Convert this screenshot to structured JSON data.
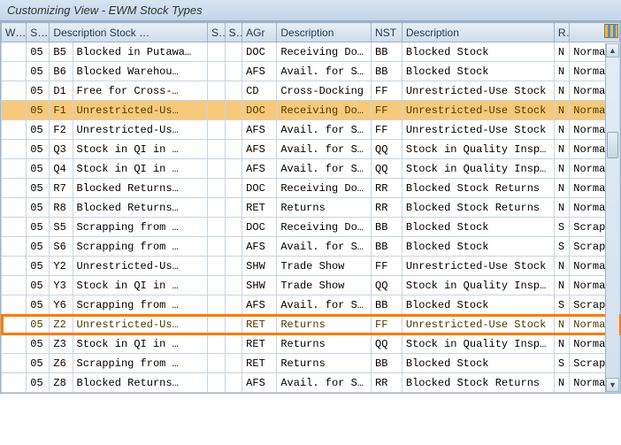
{
  "window": {
    "title": "Customizing View - EWM Stock Types"
  },
  "columns": {
    "w": "W…",
    "s1": "S…",
    "desc1": "Description Stock …",
    "s3": "S…",
    "s4": "S…",
    "agr": "AGr",
    "desc2": "Description",
    "nst": "NST",
    "desc3": "Description",
    "r": "R.",
    "last": ""
  },
  "rows": [
    {
      "w": "",
      "s1": "05",
      "s2": "B5",
      "desc1": "Blocked in Putawa…",
      "agr": "DOC",
      "desc2": "Receiving Do…",
      "nst": "BB",
      "desc3": "Blocked Stock",
      "r": "N",
      "last": "Norma",
      "sel": false,
      "hl": false
    },
    {
      "w": "",
      "s1": "05",
      "s2": "B6",
      "desc1": "Blocked Warehou…",
      "agr": "AFS",
      "desc2": "Avail. for Sale",
      "nst": "BB",
      "desc3": "Blocked Stock",
      "r": "N",
      "last": "Norma",
      "sel": false,
      "hl": false
    },
    {
      "w": "",
      "s1": "05",
      "s2": "D1",
      "desc1": "Free for Cross-…",
      "agr": "CD",
      "desc2": "Cross-Docking",
      "nst": "FF",
      "desc3": "Unrestricted-Use Stock",
      "r": "N",
      "last": "Norma",
      "sel": false,
      "hl": false
    },
    {
      "w": "",
      "s1": "05",
      "s2": "F1",
      "desc1": "Unrestricted-Us…",
      "agr": "DOC",
      "desc2": "Receiving Do…",
      "nst": "FF",
      "desc3": "Unrestricted-Use Stock",
      "r": "N",
      "last": "Norma",
      "sel": true,
      "hl": false
    },
    {
      "w": "",
      "s1": "05",
      "s2": "F2",
      "desc1": "Unrestricted-Us…",
      "agr": "AFS",
      "desc2": "Avail. for Sale",
      "nst": "FF",
      "desc3": "Unrestricted-Use Stock",
      "r": "N",
      "last": "Norma",
      "sel": false,
      "hl": false
    },
    {
      "w": "",
      "s1": "05",
      "s2": "Q3",
      "desc1": "Stock in QI in …",
      "agr": "AFS",
      "desc2": "Avail. for Sale",
      "nst": "QQ",
      "desc3": "Stock in Quality Inspect…",
      "r": "N",
      "last": "Norma",
      "sel": false,
      "hl": false
    },
    {
      "w": "",
      "s1": "05",
      "s2": "Q4",
      "desc1": "Stock in QI in …",
      "agr": "AFS",
      "desc2": "Avail. for Sale",
      "nst": "QQ",
      "desc3": "Stock in Quality Inspect…",
      "r": "N",
      "last": "Norma",
      "sel": false,
      "hl": false
    },
    {
      "w": "",
      "s1": "05",
      "s2": "R7",
      "desc1": "Blocked Returns…",
      "agr": "DOC",
      "desc2": "Receiving Do…",
      "nst": "RR",
      "desc3": "Blocked Stock Returns",
      "r": "N",
      "last": "Norma",
      "sel": false,
      "hl": false
    },
    {
      "w": "",
      "s1": "05",
      "s2": "R8",
      "desc1": "Blocked Returns…",
      "agr": "RET",
      "desc2": "Returns",
      "nst": "RR",
      "desc3": "Blocked Stock Returns",
      "r": "N",
      "last": "Norma",
      "sel": false,
      "hl": false
    },
    {
      "w": "",
      "s1": "05",
      "s2": "S5",
      "desc1": "Scrapping from …",
      "agr": "DOC",
      "desc2": "Receiving Do…",
      "nst": "BB",
      "desc3": "Blocked Stock",
      "r": "S",
      "last": "Scrap",
      "sel": false,
      "hl": false
    },
    {
      "w": "",
      "s1": "05",
      "s2": "S6",
      "desc1": "Scrapping from …",
      "agr": "AFS",
      "desc2": "Avail. for Sale",
      "nst": "BB",
      "desc3": "Blocked Stock",
      "r": "S",
      "last": "Scrap",
      "sel": false,
      "hl": false
    },
    {
      "w": "",
      "s1": "05",
      "s2": "Y2",
      "desc1": "Unrestricted-Us…",
      "agr": "SHW",
      "desc2": "Trade Show",
      "nst": "FF",
      "desc3": "Unrestricted-Use Stock",
      "r": "N",
      "last": "Norma",
      "sel": false,
      "hl": false
    },
    {
      "w": "",
      "s1": "05",
      "s2": "Y3",
      "desc1": "Stock in QI in …",
      "agr": "SHW",
      "desc2": "Trade Show",
      "nst": "QQ",
      "desc3": "Stock in Quality Inspect…",
      "r": "N",
      "last": "Norma",
      "sel": false,
      "hl": false
    },
    {
      "w": "",
      "s1": "05",
      "s2": "Y6",
      "desc1": "Scrapping from …",
      "agr": "AFS",
      "desc2": "Avail. for Sale",
      "nst": "BB",
      "desc3": "Blocked Stock",
      "r": "S",
      "last": "Scrap",
      "sel": false,
      "hl": false
    },
    {
      "w": "",
      "s1": "05",
      "s2": "Z2",
      "desc1": "Unrestricted-Us…",
      "agr": "RET",
      "desc2": "Returns",
      "nst": "FF",
      "desc3": "Unrestricted-Use Stock",
      "r": "N",
      "last": "Norma",
      "sel": true,
      "hl": true
    },
    {
      "w": "",
      "s1": "05",
      "s2": "Z3",
      "desc1": "Stock in QI in …",
      "agr": "RET",
      "desc2": "Returns",
      "nst": "QQ",
      "desc3": "Stock in Quality Inspect…",
      "r": "N",
      "last": "Norma",
      "sel": false,
      "hl": false
    },
    {
      "w": "",
      "s1": "05",
      "s2": "Z6",
      "desc1": "Scrapping from …",
      "agr": "RET",
      "desc2": "Returns",
      "nst": "BB",
      "desc3": "Blocked Stock",
      "r": "S",
      "last": "Scrap",
      "sel": false,
      "hl": false
    },
    {
      "w": "",
      "s1": "05",
      "s2": "Z8",
      "desc1": "Blocked Returns…",
      "agr": "AFS",
      "desc2": "Avail. for Sale",
      "nst": "RR",
      "desc3": "Blocked Stock Returns",
      "r": "N",
      "last": "Norma",
      "sel": false,
      "hl": false
    }
  ]
}
